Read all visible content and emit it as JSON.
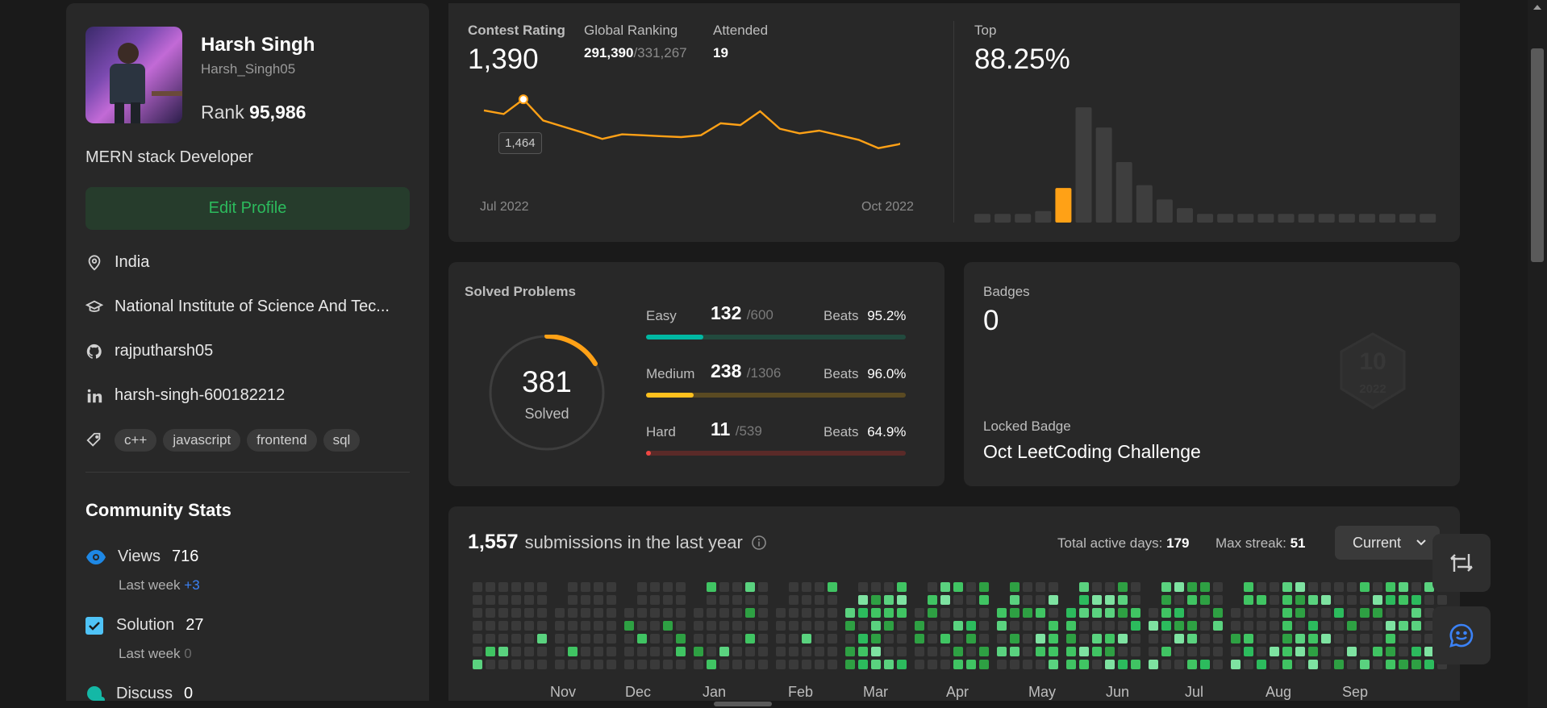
{
  "profile": {
    "name": "Harsh Singh",
    "username": "Harsh_Singh05",
    "rank_label": "Rank",
    "rank_value": "95,986",
    "bio": "MERN stack Developer",
    "edit_label": "Edit Profile",
    "location": "India",
    "school": "National Institute of Science And Tec...",
    "github": "rajputharsh05",
    "linkedin": "harsh-singh-600182212",
    "skills": [
      "c++",
      "javascript",
      "frontend",
      "sql"
    ]
  },
  "community": {
    "title": "Community Stats",
    "views_label": "Views",
    "views_value": "716",
    "views_lastweek_label": "Last week",
    "views_lastweek_value": "+3",
    "solution_label": "Solution",
    "solution_value": "27",
    "solution_lastweek_label": "Last week",
    "solution_lastweek_value": "0",
    "discuss_label": "Discuss",
    "discuss_value": "0"
  },
  "contest": {
    "rating_label": "Contest Rating",
    "rating_value": "1,390",
    "global_label": "Global Ranking",
    "global_value": "291,390",
    "global_total": "/331,267",
    "attended_label": "Attended",
    "attended_value": "19",
    "tooltip": "1,464",
    "x_start": "Jul 2022",
    "x_end": "Oct 2022",
    "top_label": "Top",
    "top_value": "88.25%"
  },
  "chart_data": [
    {
      "type": "line",
      "title": "Contest Rating",
      "x": [
        1,
        2,
        3,
        4,
        5,
        6,
        7,
        8,
        9,
        10,
        11,
        12,
        13,
        14,
        15,
        16,
        17,
        18,
        19,
        20,
        21,
        22,
        23
      ],
      "values": [
        1440,
        1432,
        1464,
        1418,
        1405,
        1392,
        1378,
        1388,
        1386,
        1384,
        1382,
        1386,
        1412,
        1408,
        1438,
        1400,
        1390,
        1396,
        1386,
        1376,
        1358,
        1366,
        1380
      ],
      "ylim": [
        1340,
        1480
      ],
      "xlabel": "",
      "ylabel": ""
    },
    {
      "type": "bar",
      "title": "",
      "values": [
        3,
        3,
        3,
        4,
        12,
        40,
        33,
        21,
        13,
        8,
        5,
        3,
        3,
        3,
        3,
        3,
        3,
        3,
        3,
        3,
        3,
        3,
        3
      ],
      "highlight_index": 4,
      "ylim": [
        0,
        42
      ]
    }
  ],
  "solved": {
    "title": "Solved Problems",
    "total": "381",
    "total_label": "Solved",
    "fraction": 0.15,
    "easy_label": "Easy",
    "easy_value": "132",
    "easy_total": "/600",
    "easy_beats_label": "Beats",
    "easy_beats": "95.2%",
    "easy_fraction": 0.22,
    "medium_label": "Medium",
    "medium_value": "238",
    "medium_total": "/1306",
    "medium_beats_label": "Beats",
    "medium_beats": "96.0%",
    "medium_fraction": 0.182,
    "hard_label": "Hard",
    "hard_value": "11",
    "hard_total": "/539",
    "hard_beats_label": "Beats",
    "hard_beats": "64.9%",
    "hard_fraction": 0.02
  },
  "badges": {
    "title": "Badges",
    "count": "0",
    "locked_label": "Locked Badge",
    "locked_name": "Oct LeetCoding Challenge",
    "emblem_text": "10",
    "emblem_year": "2022"
  },
  "submissions": {
    "count": "1,557",
    "text": "submissions in the last year",
    "active_label": "Total active days:",
    "active_value": "179",
    "streak_label": "Max streak:",
    "streak_value": "51",
    "dropdown": "Current",
    "months": [
      "Nov",
      "Dec",
      "Jan",
      "Feb",
      "Mar",
      "Apr",
      "May",
      "Jun",
      "Jul",
      "Aug",
      "Sep"
    ]
  },
  "colors": {
    "accent_orange": "#ffa116",
    "easy": "#00b8a3",
    "medium": "#ffc01e",
    "hard": "#ef4743",
    "green": "#2cbb5d"
  }
}
